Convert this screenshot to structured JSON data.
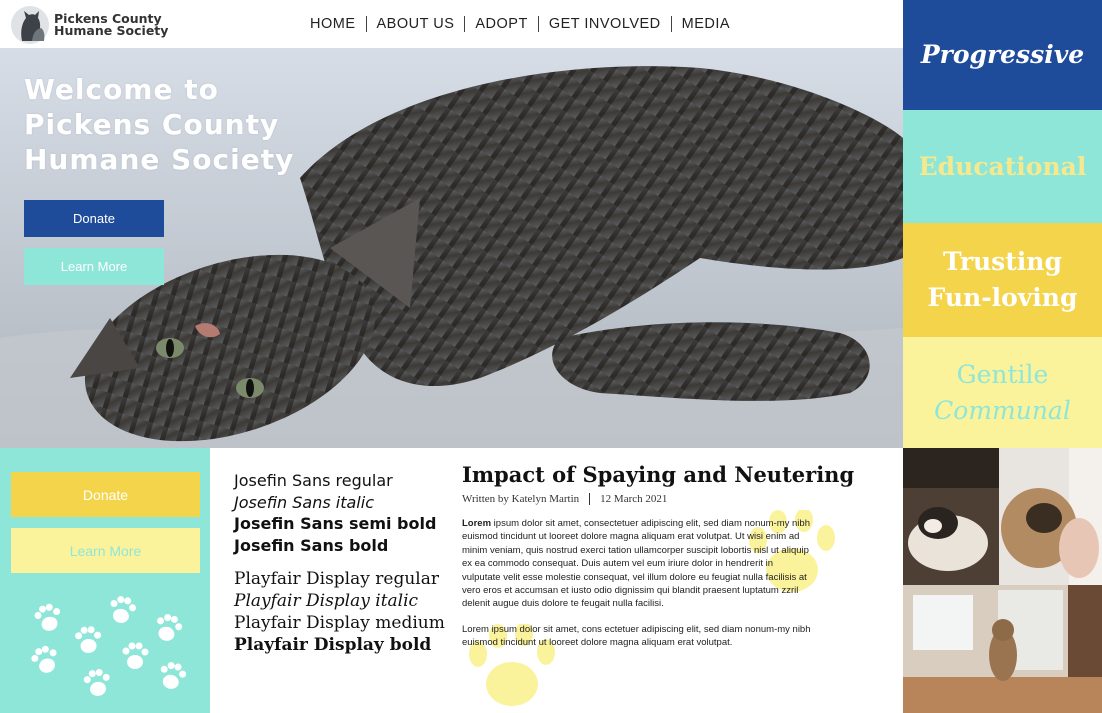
{
  "header": {
    "logo_line1": "Pickens County",
    "logo_line2": "Humane Society",
    "nav": [
      "HOME",
      "ABOUT US",
      "ADOPT",
      "GET INVOLVED",
      "MEDIA"
    ]
  },
  "hero": {
    "title_line1": "Welcome to",
    "title_line2": "Pickens County",
    "title_line3": "Humane Society",
    "donate_label": "Donate",
    "learn_label": "Learn More"
  },
  "brand_words": {
    "word1": "Progressive",
    "word2": "Educational",
    "word3a": "Trusting",
    "word3b": "Fun-loving",
    "word4a": "Gentile",
    "word4b": "Communal"
  },
  "left_panel": {
    "donate_label": "Donate",
    "learn_label": "Learn More"
  },
  "specimens": {
    "sans": [
      "Josefin Sans regular",
      "Josefin Sans italic",
      "Josefin Sans semi bold",
      "Josefin Sans bold"
    ],
    "serif": [
      "Playfair Display regular",
      "Playfair Display italic",
      "Playfair Display medium",
      "Playfair Display bold"
    ]
  },
  "article": {
    "title": "Impact of Spaying and Neutering",
    "author": "Written by Katelyn Martin",
    "date": "12 March 2021",
    "p1_lead": "Lorem",
    "p1_rest": " ipsum dolor sit amet, consectetuer adipiscing elit, sed diam nonum-my nibh euismod tincidunt ut looreet dolore magna aliquam erat volutpat. Ut wisi enim ad minim veniam, quis nostrud exerci tation ullamcorper suscipit lobortis nisl ut aliquip ex ea commodo consequat. Duis autem vel eum iriure dolor in hendrerit in vulputate velit esse molestie consequat, vel illum dolore eu feugiat nulla facilisis at vero eros et accumsan et iusto odio dignissim qui blandit praesent luptatum zzril delenit augue duis dolore te feugait nulla facilisi.",
    "p2": "Lorem ipsum dolor sit amet, cons ectetuer adipiscing elit, sed diam nonum-my nibh euismod tincidunt ut looreet dolore magna aliquam erat volutpat."
  },
  "colors": {
    "navy": "#1f4b9b",
    "mint": "#8ee6d9",
    "gold": "#f4d44a",
    "cream": "#fbf39c"
  }
}
